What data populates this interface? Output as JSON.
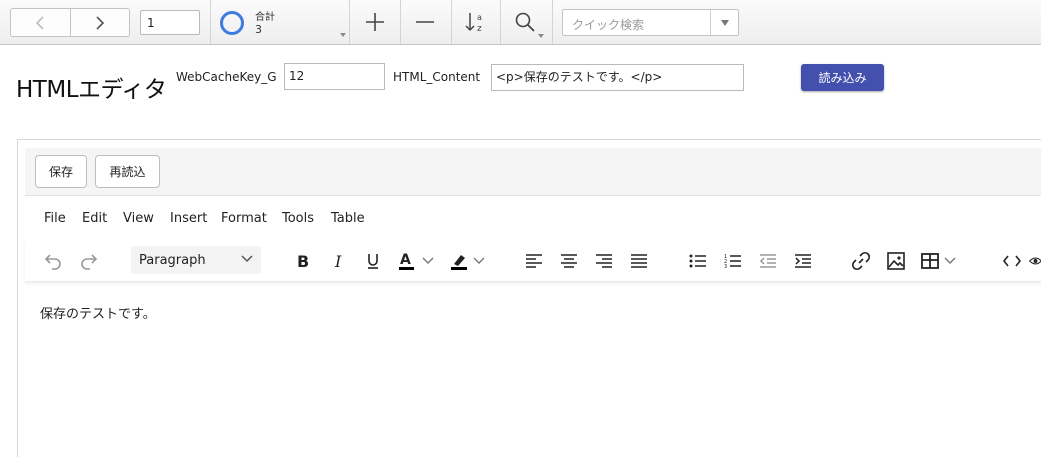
{
  "toolbar": {
    "record_number": "1",
    "total_label": "合計",
    "total_count": "3",
    "quick_search_placeholder": "クイック検索"
  },
  "header": {
    "title": "HTMLエディタ",
    "key_label": "WebCacheKey_G",
    "key_value": "12",
    "content_label": "HTML_Content",
    "content_value": "<p>保存のテストです。</p>",
    "load_button": "読み込み"
  },
  "viewer": {
    "save_button": "保存",
    "reload_button": "再読込",
    "menu": [
      "File",
      "Edit",
      "View",
      "Insert",
      "Format",
      "Tools",
      "Table"
    ],
    "block_format": "Paragraph",
    "body_text": "保存のテストです。"
  },
  "colors": {
    "load_button": "#4350ad",
    "spinner_ring": "#3d7be0",
    "text_color_bar": "#000000"
  }
}
